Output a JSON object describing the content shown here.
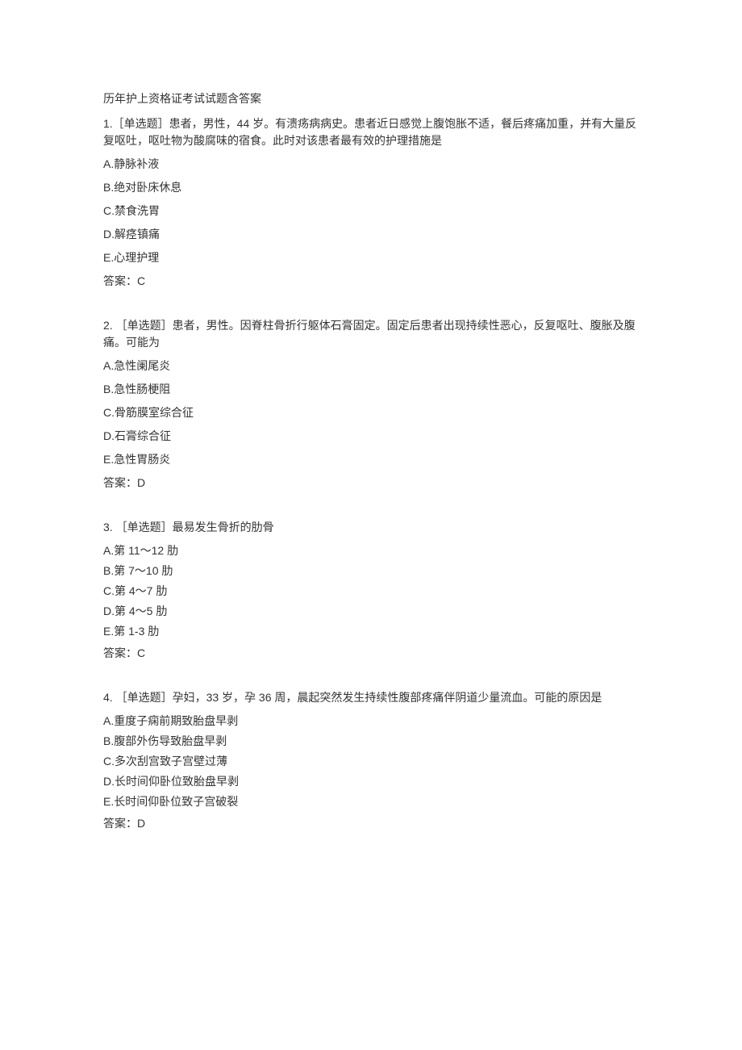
{
  "title": "历年护上资格证考试试题含答案",
  "questions": [
    {
      "stem": "1.［单选题］患者，男性，44 岁。有溃疡病病史。患者近日感觉上腹饱胀不适，餐后疼痛加重，并有大量反复呕吐，呕吐物为酸腐味的宿食。此时对该患者最有效的护理措施是",
      "options": [
        "A.静脉补液",
        "B.绝对卧床休息",
        "C.禁食洗胃",
        "D.解痉镇痛",
        "E.心理护理"
      ],
      "answer": "答案：C",
      "style": "loose"
    },
    {
      "stem": "2. ［单选题］患者，男性。因脊柱骨折行躯体石膏固定。固定后患者出现持续性恶心，反复呕吐、腹胀及腹痛。可能为",
      "options": [
        "A.急性阑尾炎",
        "B.急性肠梗阻",
        "C.骨筋膜室综合征",
        "D.石膏综合征",
        "E.急性胃肠炎"
      ],
      "answer": "答案：D",
      "style": "loose"
    },
    {
      "stem": "3. ［单选题］最易发生骨折的肋骨",
      "options": [
        "A.第 11～12 肋",
        "B.第 7～10 肋",
        "C.第 4～7 肋",
        "D.第 4～5 肋",
        "E.第 1-3 肋"
      ],
      "answer": "答案：C",
      "style": "tight"
    },
    {
      "stem": "4. ［单选题］孕妇，33 岁，孕 36 周，晨起突然发生持续性腹部疼痛伴阴道少量流血。可能的原因是",
      "options": [
        "A.重度子痫前期致胎盘早剥",
        "B.腹部外伤导致胎盘早剥",
        "C.多次刮宫致子宫壁过薄",
        "D.长时间仰卧位致胎盘早剥",
        "E.长时间仰卧位致子宫破裂"
      ],
      "answer": "答案：D",
      "style": "tight"
    }
  ]
}
